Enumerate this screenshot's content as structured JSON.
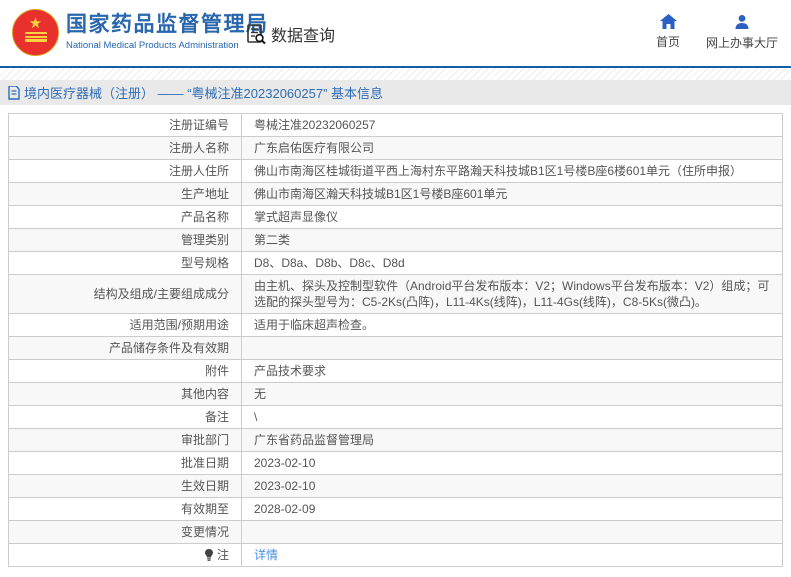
{
  "header": {
    "emblem": "national-emblem",
    "site_name": "国家药品监督管理局",
    "site_name_en": "National Medical Products Administration",
    "nav": {
      "data_query": "数据查询",
      "home": "首页",
      "service_hall": "网上办事大厅"
    }
  },
  "breadcrumb": {
    "text": "境内医疗器械（注册） —— “粤械注准20232060257” 基本信息"
  },
  "table": {
    "rows": [
      {
        "label": "注册证编号",
        "value": "粤械注准20232060257"
      },
      {
        "label": "注册人名称",
        "value": "广东启佑医疗有限公司"
      },
      {
        "label": "注册人住所",
        "value": "佛山市南海区桂城街道平西上海村东平路瀚天科技城B1区1号楼B座6楼601单元（住所申报）"
      },
      {
        "label": "生产地址",
        "value": "佛山市南海区瀚天科技城B1区1号楼B座601单元"
      },
      {
        "label": "产品名称",
        "value": "掌式超声显像仪"
      },
      {
        "label": "管理类别",
        "value": "第二类"
      },
      {
        "label": "型号规格",
        "value": "D8、D8a、D8b、D8c、D8d"
      },
      {
        "label": "结构及组成/主要组成成分",
        "value": "由主机、探头及控制型软件（Android平台发布版本：V2；Windows平台发布版本：V2）组成；可选配的探头型号为：C5-2Ks(凸阵)，L11-4Ks(线阵)，L11-4Gs(线阵)，C8-5Ks(微凸)。",
        "tall": true
      },
      {
        "label": "适用范围/预期用途",
        "value": "适用于临床超声检查。"
      },
      {
        "label": "产品储存条件及有效期",
        "value": ""
      },
      {
        "label": "附件",
        "value": "产品技术要求"
      },
      {
        "label": "其他内容",
        "value": "无"
      },
      {
        "label": "备注",
        "value": "\\"
      },
      {
        "label": "审批部门",
        "value": "广东省药品监督管理局"
      },
      {
        "label": "批准日期",
        "value": "2023-02-10"
      },
      {
        "label": "生效日期",
        "value": "2023-02-10"
      },
      {
        "label": "有效期至",
        "value": "2028-02-09"
      },
      {
        "label": "变更情况",
        "value": ""
      },
      {
        "label": "注",
        "value": "详情",
        "link": true,
        "label_icon": "note-lightbulb-icon"
      }
    ]
  },
  "colors": {
    "brand_blue": "#2a66ac",
    "divider_blue": "#1460a8",
    "breadcrumb_bg": "#e9e9e9",
    "breadcrumb_text": "#2e6cb5",
    "link_blue": "#4a90e2",
    "table_border": "#cccccc",
    "alt_row_bg": "#f8f8f8",
    "emblem_red": "#e8302c",
    "emblem_gold": "#f8d341"
  }
}
